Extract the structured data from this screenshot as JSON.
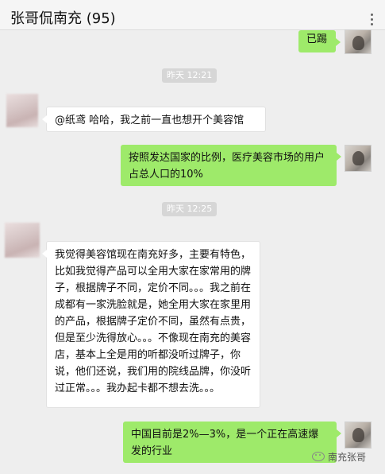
{
  "header": {
    "title": "张哥侃南充 (95)"
  },
  "messages": {
    "m1": "已踢",
    "t1": "昨天 12:21",
    "m2": "@纸鸢 哈哈，我之前一直也想开个美容馆",
    "m3": "按照发达国家的比例，医疗美容市场的用户占总人口的10%",
    "t2": "昨天 12:25",
    "m4": "我觉得美容馆现在南充好多，主要有特色，比如我觉得产品可以全用大家在家常用的牌子，根据牌子不同，定价不同。。。我之前在成都有一家洗脸就是，她全用大家在家里用的产品，根据牌子定价不同，虽然有点贵，但是至少洗得放心。。。不像现在南充的美容店，基本上全是用的听都没听过牌子，你说，他们还说，我们用的院线品牌，你没听过正常。。。我办起卡都不想去洗。。。",
    "m5": "中国目前是2%—3%，是一个正在高速爆发的行业"
  },
  "watermark": {
    "text": "南充张哥"
  },
  "colors": {
    "sent_bubble": "#9eea6a",
    "received_bubble": "#ffffff",
    "background": "#eeeeee"
  }
}
